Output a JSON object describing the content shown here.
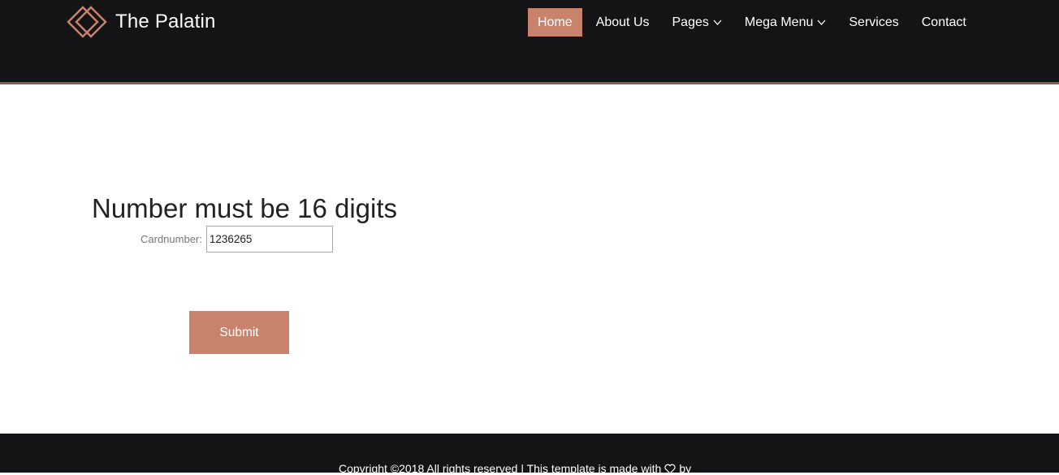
{
  "brand": {
    "name": "The Palatin",
    "logo_icon": "double-diamond-icon",
    "accent_color": "#c9826c"
  },
  "nav": {
    "items": [
      {
        "label": "Home",
        "active": true
      },
      {
        "label": "About Us"
      },
      {
        "label": "Pages",
        "has_dropdown": true
      },
      {
        "label": "Mega Menu",
        "has_dropdown": true
      },
      {
        "label": "Services"
      },
      {
        "label": "Contact"
      }
    ]
  },
  "form": {
    "heading": "Number must be 16 digits",
    "cardnumber_label": "Cardnumber:",
    "cardnumber_value": "1236265",
    "submit_label": "Submit"
  },
  "footer": {
    "copyright_pre": "Copyright ©2018 All rights reserved | This template is made with",
    "heart_icon": "heart-icon",
    "copyright_post": "by"
  }
}
